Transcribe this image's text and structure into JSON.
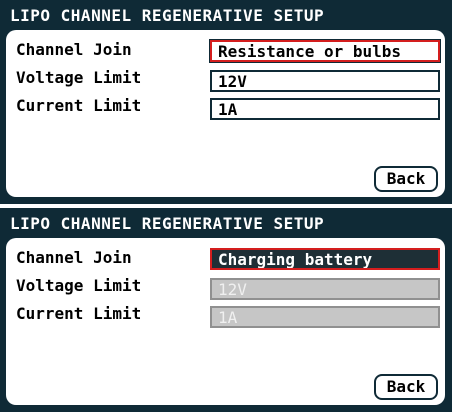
{
  "screens": [
    {
      "title": "LIPO CHANNEL REGENERATIVE SETUP",
      "rows": [
        {
          "label": "Channel Join",
          "value": "Resistance or bulbs"
        },
        {
          "label": "Voltage Limit",
          "value": "12V"
        },
        {
          "label": "Current Limit",
          "value": "1A"
        }
      ],
      "back_label": "Back"
    },
    {
      "title": "LIPO CHANNEL REGENERATIVE SETUP",
      "rows": [
        {
          "label": "Channel Join",
          "value": "Charging battery"
        },
        {
          "label": "Voltage Limit",
          "value": "12V"
        },
        {
          "label": "Current Limit",
          "value": "1A"
        }
      ],
      "back_label": "Back"
    }
  ],
  "colors": {
    "screen_bg": "#0f2a36",
    "panel_bg": "#ffffff",
    "selection_border": "#d41e1e",
    "disabled_field_bg": "#c6c6c6"
  }
}
